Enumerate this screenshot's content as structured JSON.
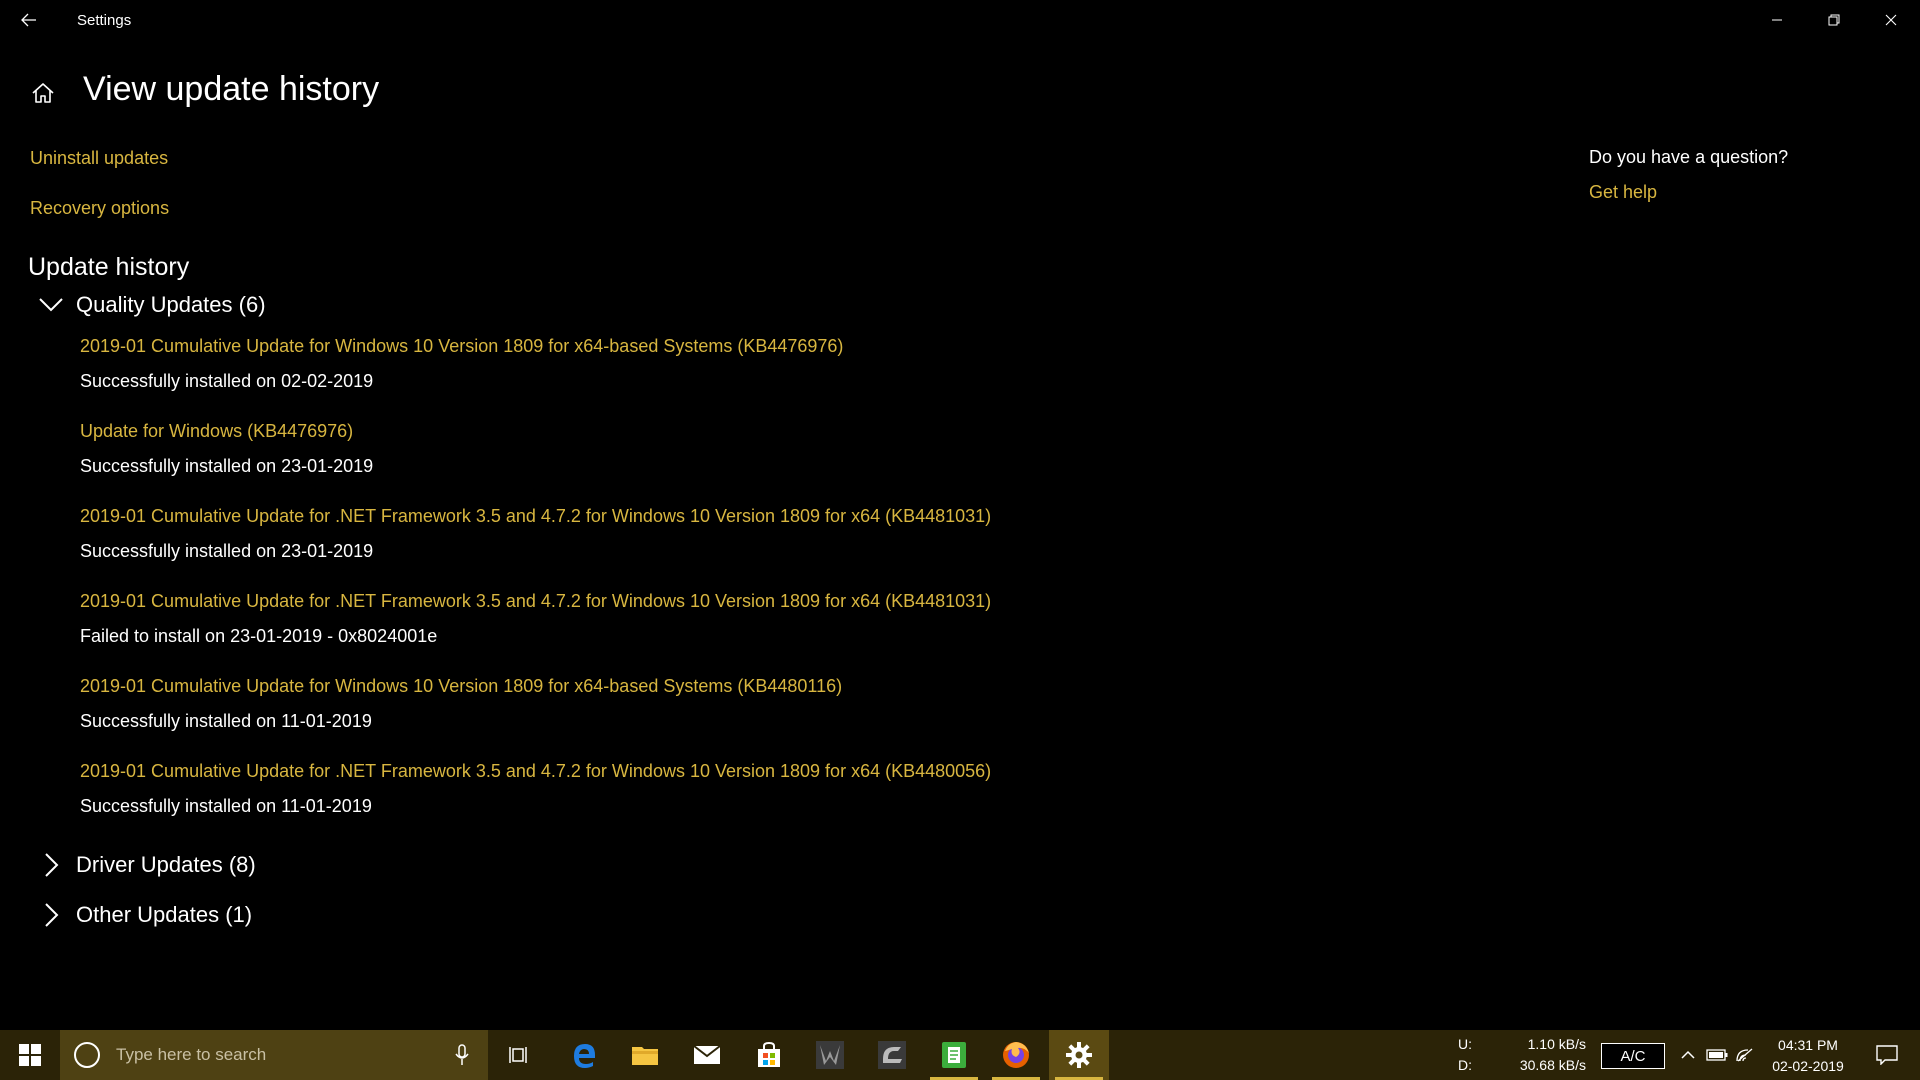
{
  "window": {
    "title": "Settings"
  },
  "page": {
    "title": "View update history"
  },
  "links": {
    "uninstall": "Uninstall updates",
    "recovery": "Recovery options"
  },
  "section": {
    "title": "Update history"
  },
  "groups": {
    "quality": {
      "label": "Quality Updates (6)",
      "items": [
        {
          "name": "2019-01 Cumulative Update for Windows 10 Version 1809 for x64-based Systems (KB4476976)",
          "status": "Successfully installed on 02-02-2019"
        },
        {
          "name": "Update for Windows (KB4476976)",
          "status": "Successfully installed on 23-01-2019"
        },
        {
          "name": "2019-01 Cumulative Update for .NET Framework 3.5 and 4.7.2 for Windows 10 Version 1809 for x64 (KB4481031)",
          "status": "Successfully installed on 23-01-2019"
        },
        {
          "name": "2019-01 Cumulative Update for .NET Framework 3.5 and 4.7.2 for Windows 10 Version 1809 for x64 (KB4481031)",
          "status": "Failed to install on 23-01-2019 - 0x8024001e"
        },
        {
          "name": "2019-01 Cumulative Update for Windows 10 Version 1809 for x64-based Systems (KB4480116)",
          "status": "Successfully installed on 11-01-2019"
        },
        {
          "name": "2019-01 Cumulative Update for .NET Framework 3.5 and 4.7.2 for Windows 10 Version 1809 for x64 (KB4480056)",
          "status": "Successfully installed on 11-01-2019"
        }
      ]
    },
    "driver": {
      "label": "Driver Updates (8)"
    },
    "other": {
      "label": "Other Updates (1)"
    }
  },
  "sidebar": {
    "question": "Do you have a question?",
    "help": "Get help"
  },
  "taskbar": {
    "search_placeholder": "Type here to search",
    "network": {
      "upload_label": "U:",
      "upload_value": "1.10 kB/s",
      "download_label": "D:",
      "download_value": "30.68 kB/s"
    },
    "ac_label": "A/C",
    "clock": {
      "time": "04:31 PM",
      "date": "02-02-2019"
    }
  },
  "colors": {
    "accent": "#d8b640",
    "background": "#000000",
    "taskbar": "#2b2307",
    "search_box": "#4e4113"
  }
}
